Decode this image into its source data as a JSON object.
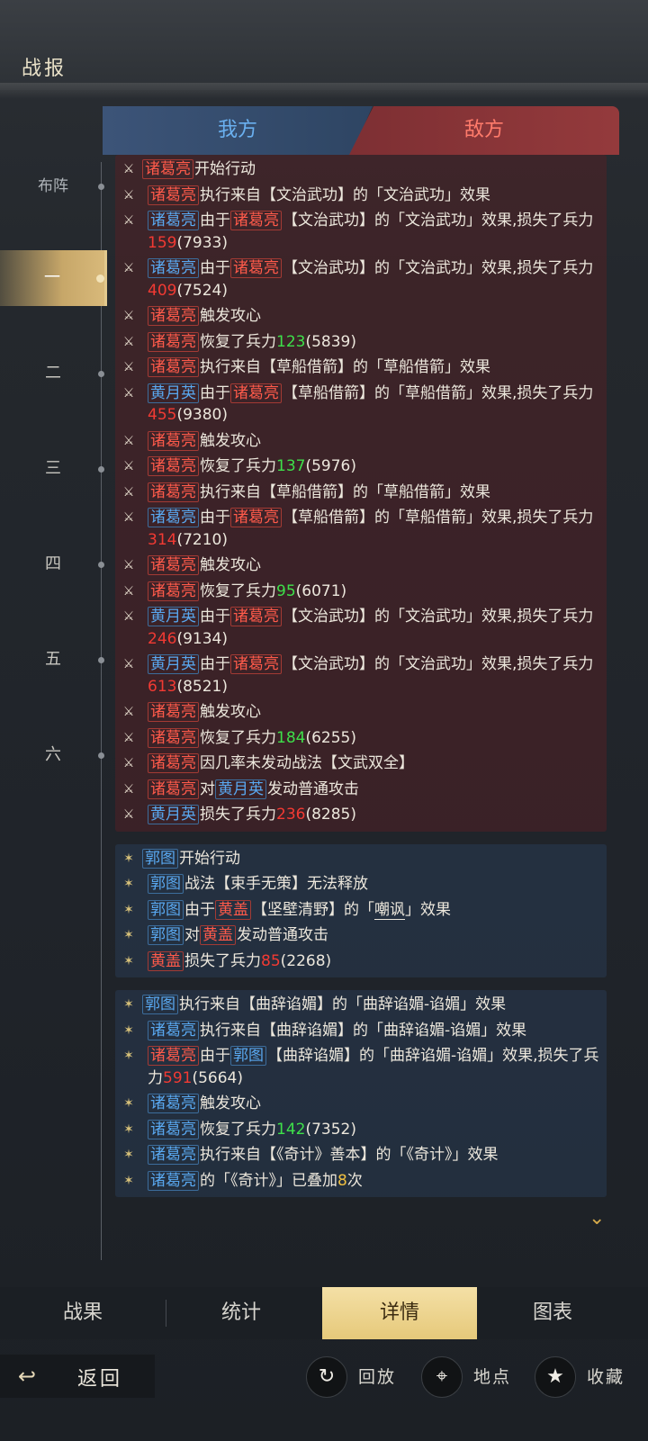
{
  "header": {
    "title": "战报"
  },
  "rounds": {
    "items": [
      "布阵",
      "一",
      "二",
      "三",
      "四",
      "五",
      "六"
    ],
    "active_index": 1
  },
  "side_tabs": {
    "our": "我方",
    "enemy": "敌方"
  },
  "blocks": [
    {
      "side": "enemy",
      "lines": [
        [
          {
            "n": "诸葛亮",
            "c": "r"
          },
          {
            "t": "开始行动"
          }
        ],
        [
          {
            "n": "诸葛亮",
            "c": "r"
          },
          {
            "t": "执行来自【文治武功】的「文治武功」效果"
          }
        ],
        [
          {
            "n": "诸葛亮",
            "c": "b"
          },
          {
            "t": "由于"
          },
          {
            "n": "诸葛亮",
            "c": "r"
          },
          {
            "t": "【文治武功】的「文治武功」效果,损失了兵力"
          },
          {
            "v": "159",
            "c": "r"
          },
          {
            "t": "(7933)"
          }
        ],
        [
          {
            "n": "诸葛亮",
            "c": "b"
          },
          {
            "t": "由于"
          },
          {
            "n": "诸葛亮",
            "c": "r"
          },
          {
            "t": "【文治武功】的「文治武功」效果,损失了兵力"
          },
          {
            "v": "409",
            "c": "r"
          },
          {
            "t": "(7524)"
          }
        ],
        [
          {
            "n": "诸葛亮",
            "c": "r"
          },
          {
            "t": "触发攻心"
          }
        ],
        [
          {
            "n": "诸葛亮",
            "c": "r"
          },
          {
            "t": "恢复了兵力"
          },
          {
            "v": "123",
            "c": "g"
          },
          {
            "t": "(5839)"
          }
        ],
        [
          {
            "n": "诸葛亮",
            "c": "r"
          },
          {
            "t": "执行来自【草船借箭】的「草船借箭」效果"
          }
        ],
        [
          {
            "n": "黄月英",
            "c": "b"
          },
          {
            "t": "由于"
          },
          {
            "n": "诸葛亮",
            "c": "r"
          },
          {
            "t": "【草船借箭】的「草船借箭」效果,损失了兵力"
          },
          {
            "v": "455",
            "c": "r"
          },
          {
            "t": "(9380)"
          }
        ],
        [
          {
            "n": "诸葛亮",
            "c": "r"
          },
          {
            "t": "触发攻心"
          }
        ],
        [
          {
            "n": "诸葛亮",
            "c": "r"
          },
          {
            "t": "恢复了兵力"
          },
          {
            "v": "137",
            "c": "g"
          },
          {
            "t": "(5976)"
          }
        ],
        [
          {
            "n": "诸葛亮",
            "c": "r"
          },
          {
            "t": "执行来自【草船借箭】的「草船借箭」效果"
          }
        ],
        [
          {
            "n": "诸葛亮",
            "c": "b"
          },
          {
            "t": "由于"
          },
          {
            "n": "诸葛亮",
            "c": "r"
          },
          {
            "t": "【草船借箭】的「草船借箭」效果,损失了兵力"
          },
          {
            "v": "314",
            "c": "r"
          },
          {
            "t": "(7210)"
          }
        ],
        [
          {
            "n": "诸葛亮",
            "c": "r"
          },
          {
            "t": "触发攻心"
          }
        ],
        [
          {
            "n": "诸葛亮",
            "c": "r"
          },
          {
            "t": "恢复了兵力"
          },
          {
            "v": "95",
            "c": "g"
          },
          {
            "t": "(6071)"
          }
        ],
        [
          {
            "n": "黄月英",
            "c": "b"
          },
          {
            "t": "由于"
          },
          {
            "n": "诸葛亮",
            "c": "r"
          },
          {
            "t": "【文治武功】的「文治武功」效果,损失了兵力"
          },
          {
            "v": "246",
            "c": "r"
          },
          {
            "t": "(9134)"
          }
        ],
        [
          {
            "n": "黄月英",
            "c": "b"
          },
          {
            "t": "由于"
          },
          {
            "n": "诸葛亮",
            "c": "r"
          },
          {
            "t": "【文治武功】的「文治武功」效果,损失了兵力"
          },
          {
            "v": "613",
            "c": "r"
          },
          {
            "t": "(8521)"
          }
        ],
        [
          {
            "n": "诸葛亮",
            "c": "r"
          },
          {
            "t": "触发攻心"
          }
        ],
        [
          {
            "n": "诸葛亮",
            "c": "r"
          },
          {
            "t": "恢复了兵力"
          },
          {
            "v": "184",
            "c": "g"
          },
          {
            "t": "(6255)"
          }
        ],
        [
          {
            "n": "诸葛亮",
            "c": "r"
          },
          {
            "t": "因几率未发动战法【文武双全】"
          }
        ],
        [
          {
            "n": "诸葛亮",
            "c": "r"
          },
          {
            "t": "对"
          },
          {
            "n": "黄月英",
            "c": "b"
          },
          {
            "t": "发动普通攻击"
          }
        ],
        [
          {
            "n": "黄月英",
            "c": "b"
          },
          {
            "t": "损失了兵力"
          },
          {
            "v": "236",
            "c": "r"
          },
          {
            "t": "(8285)"
          }
        ]
      ]
    },
    {
      "side": "our",
      "lines": [
        [
          {
            "n": "郭图",
            "c": "b"
          },
          {
            "t": "开始行动"
          }
        ],
        [
          {
            "n": "郭图",
            "c": "b"
          },
          {
            "t": "战法【束手无策】无法释放"
          }
        ],
        [
          {
            "n": "郭图",
            "c": "b"
          },
          {
            "t": "由于"
          },
          {
            "n": "黄盖",
            "c": "r"
          },
          {
            "t": "【坚壁清野】的「"
          },
          {
            "u": "嘲讽"
          },
          {
            "t": "」效果"
          }
        ],
        [
          {
            "n": "郭图",
            "c": "b"
          },
          {
            "t": "对"
          },
          {
            "n": "黄盖",
            "c": "r"
          },
          {
            "t": "发动普通攻击"
          }
        ],
        [
          {
            "n": "黄盖",
            "c": "r"
          },
          {
            "t": "损失了兵力"
          },
          {
            "v": "85",
            "c": "r"
          },
          {
            "t": "(2268)"
          }
        ]
      ]
    },
    {
      "side": "our",
      "lines": [
        [
          {
            "n": "郭图",
            "c": "b"
          },
          {
            "t": "执行来自【曲辞谄媚】的「曲辞谄媚-谄媚」效果"
          }
        ],
        [
          {
            "n": "诸葛亮",
            "c": "b"
          },
          {
            "t": "执行来自【曲辞谄媚】的「曲辞谄媚-谄媚」效果"
          }
        ],
        [
          {
            "n": "诸葛亮",
            "c": "r"
          },
          {
            "t": "由于"
          },
          {
            "n": "郭图",
            "c": "b"
          },
          {
            "t": "【曲辞谄媚】的「曲辞谄媚-谄媚」效果,损失了兵力"
          },
          {
            "v": "591",
            "c": "r"
          },
          {
            "t": "(5664)"
          }
        ],
        [
          {
            "n": "诸葛亮",
            "c": "b"
          },
          {
            "t": "触发攻心"
          }
        ],
        [
          {
            "n": "诸葛亮",
            "c": "b"
          },
          {
            "t": "恢复了兵力"
          },
          {
            "v": "142",
            "c": "g"
          },
          {
            "t": "(7352)"
          }
        ],
        [
          {
            "n": "诸葛亮",
            "c": "b"
          },
          {
            "t": "执行来自【《奇计》善本】的「《奇计》」效果"
          }
        ],
        [
          {
            "n": "诸葛亮",
            "c": "b"
          },
          {
            "t": "的「《奇计》」已叠加"
          },
          {
            "v": "8",
            "c": "y"
          },
          {
            "t": "次"
          }
        ]
      ]
    }
  ],
  "bottom_tabs": {
    "items": [
      "战果",
      "统计",
      "详情",
      "图表"
    ],
    "active_index": 2
  },
  "footer": {
    "back_label": "返回",
    "replay_label": "回放",
    "location_label": "地点",
    "favorite_label": "收藏"
  }
}
